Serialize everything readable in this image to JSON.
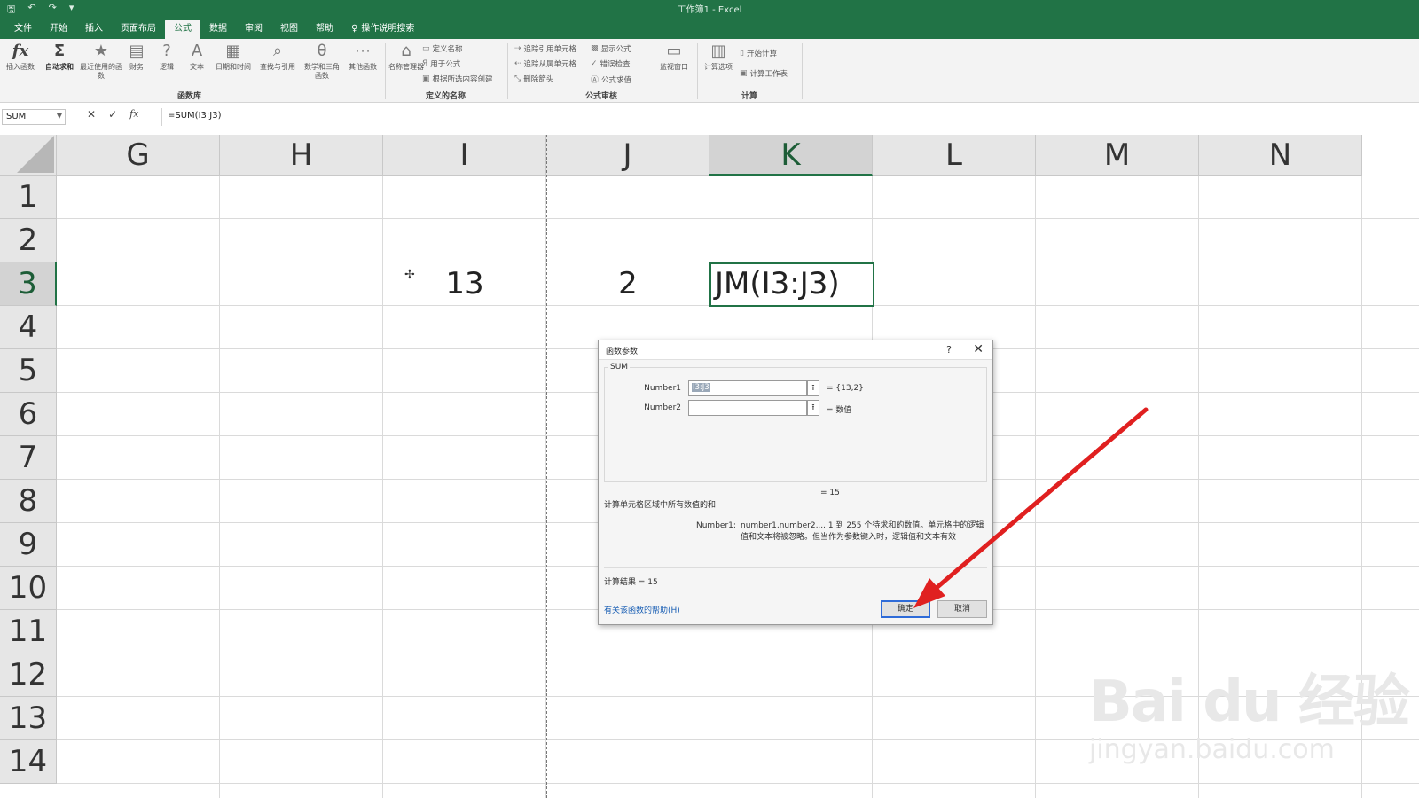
{
  "window": {
    "title": "工作簿1 - Excel"
  },
  "ribbon_tabs": [
    "文件",
    "开始",
    "插入",
    "页面布局",
    "公式",
    "数据",
    "审阅",
    "视图",
    "帮助"
  ],
  "active_tab": "公式",
  "search_tab": "操作说明搜索",
  "ribbon": {
    "buttons": [
      "插入函数",
      "自动求和",
      "最近使用的函数",
      "财务",
      "逻辑",
      "文本",
      "日期和时间",
      "查找与引用",
      "数学和三角函数",
      "其他函数",
      "名称管理器",
      "监视窗口",
      "计算选项"
    ],
    "defined_names": [
      "定义名称",
      "用于公式",
      "根据所选内容创建"
    ],
    "audit": [
      "追踪引用单元格",
      "追踪从属单元格",
      "删除箭头",
      "显示公式",
      "错误检查",
      "公式求值"
    ],
    "calc": [
      "开始计算",
      "计算工作表"
    ],
    "groups": [
      "函数库",
      "定义的名称",
      "公式审核",
      "计算"
    ]
  },
  "formula_bar": {
    "name_box": "SUM",
    "formula": "=SUM(I3:J3)"
  },
  "columns": [
    "G",
    "H",
    "I",
    "J",
    "K",
    "L",
    "M",
    "N"
  ],
  "selected_column": "K",
  "rows": [
    "1",
    "2",
    "3",
    "4",
    "5",
    "6",
    "7",
    "8",
    "9",
    "10",
    "11",
    "12",
    "13",
    "14"
  ],
  "selected_row": "3",
  "cells": {
    "I3": "13",
    "J3": "2",
    "K3": "JM(I3:J3)"
  },
  "dialog": {
    "title": "函数参数",
    "help": "?",
    "function": "SUM",
    "args": [
      {
        "label": "Number1",
        "value": "I3:J3",
        "result": "= {13,2}"
      },
      {
        "label": "Number2",
        "value": "",
        "result": "= 数值"
      }
    ],
    "eval": "= 15",
    "description": "计算单元格区域中所有数值的和",
    "arg_help_label": "Number1:",
    "arg_help_text": "number1,number2,... 1 到 255 个待求和的数值。单元格中的逻辑值和文本将被忽略。但当作为参数键入时，逻辑值和文本有效",
    "result_label": "计算结果 =",
    "result_value": "15",
    "help_link": "有关该函数的帮助(H)",
    "ok": "确定",
    "cancel": "取消"
  },
  "watermark": {
    "logo": "Bai du 经验",
    "url": "jingyan.baidu.com"
  },
  "colors": {
    "excel_green": "#217346",
    "arrow": "#e02020"
  }
}
